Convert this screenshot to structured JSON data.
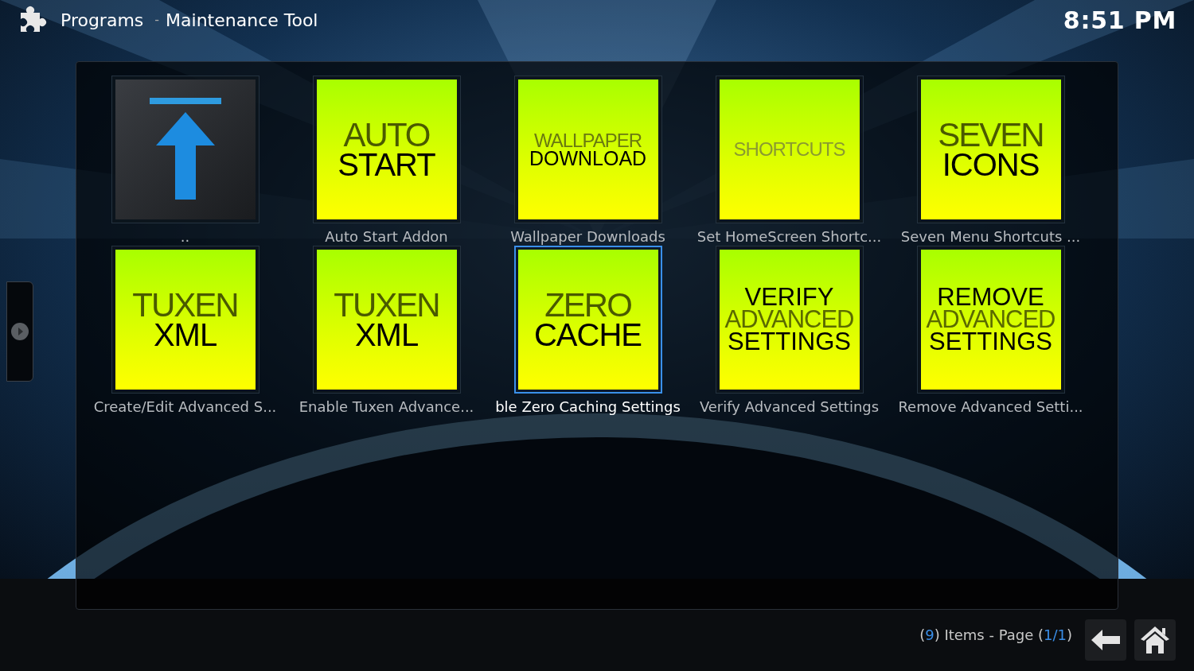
{
  "header": {
    "section": "Programs",
    "separator": "-",
    "title": "Maintenance Tool",
    "time": "8:51 PM"
  },
  "items": [
    {
      "kind": "parent",
      "label": "..",
      "selected": false
    },
    {
      "kind": "addon",
      "label": "Auto Start Addon",
      "selected": false,
      "art": [
        {
          "text": "AUTO",
          "kind": "light"
        },
        {
          "text": "START",
          "kind": "regular"
        }
      ]
    },
    {
      "kind": "addon",
      "label": "Wallpaper Downloads",
      "selected": false,
      "art": [
        {
          "text": "WALLPAPER",
          "kind": "light-small"
        },
        {
          "text": "DOWNLOAD",
          "kind": "regular-small"
        }
      ]
    },
    {
      "kind": "addon",
      "label": "Set HomeScreen Shortc...",
      "selected": false,
      "art": [
        {
          "text": "SHORTCUTS",
          "kind": "faint-small"
        }
      ]
    },
    {
      "kind": "addon",
      "label": "Seven Menu Shortcuts ...",
      "selected": false,
      "art": [
        {
          "text": "SEVEN",
          "kind": "light"
        },
        {
          "text": "ICONS",
          "kind": "regular"
        }
      ]
    },
    {
      "kind": "addon",
      "label": "Create/Edit Advanced S...",
      "selected": false,
      "art": [
        {
          "text": "TUXEN",
          "kind": "light"
        },
        {
          "text": "XML",
          "kind": "regular"
        }
      ]
    },
    {
      "kind": "addon",
      "label": "Enable Tuxen Advance...",
      "selected": false,
      "art": [
        {
          "text": "TUXEN",
          "kind": "light"
        },
        {
          "text": "XML",
          "kind": "regular"
        }
      ]
    },
    {
      "kind": "addon",
      "label": "ble Zero Caching Settings",
      "selected": true,
      "art": [
        {
          "text": "ZERO",
          "kind": "light"
        },
        {
          "text": "CACHE",
          "kind": "regular"
        }
      ]
    },
    {
      "kind": "addon",
      "label": "Verify Advanced Settings",
      "selected": false,
      "art": [
        {
          "text": "VERIFY",
          "kind": "regular-mid"
        },
        {
          "text": "ADVANCED",
          "kind": "light-mid"
        },
        {
          "text": "SETTINGS",
          "kind": "regular-mid"
        }
      ]
    },
    {
      "kind": "addon",
      "label": "Remove Advanced Setti...",
      "selected": false,
      "art": [
        {
          "text": "REMOVE",
          "kind": "regular-mid"
        },
        {
          "text": "ADVANCED",
          "kind": "light-mid"
        },
        {
          "text": "SETTINGS",
          "kind": "regular-mid"
        }
      ]
    }
  ],
  "footer": {
    "parts": [
      {
        "text": "(",
        "kind": "plain"
      },
      {
        "text": "9",
        "kind": "highlight"
      },
      {
        "text": ") Items - Page (",
        "kind": "plain"
      },
      {
        "text": "1/1",
        "kind": "highlight"
      },
      {
        "text": ")",
        "kind": "plain"
      }
    ]
  }
}
